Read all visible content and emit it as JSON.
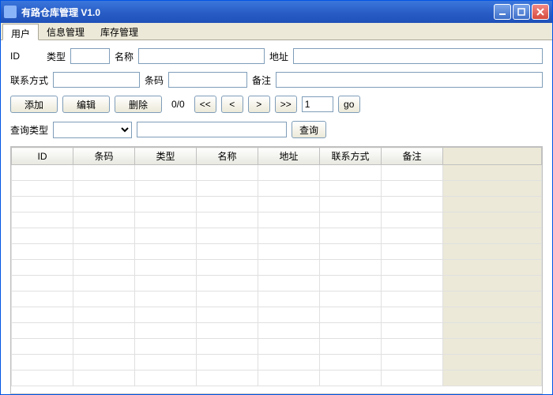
{
  "window": {
    "title": "有路仓库管理  V1.0"
  },
  "menu": {
    "user": "用户",
    "infoMgmt": "信息管理",
    "stockMgmt": "库存管理"
  },
  "form": {
    "idLabel": "ID",
    "typeLabel": "类型",
    "nameLabel": "名称",
    "addressLabel": "地址",
    "contactLabel": "联系方式",
    "barcodeLabel": "条码",
    "remarkLabel": "备注",
    "idValue": "",
    "typeValue": "",
    "nameValue": "",
    "addressValue": "",
    "contactValue": "",
    "barcodeValue": "",
    "remarkValue": ""
  },
  "toolbar": {
    "addLabel": "添加",
    "editLabel": "编辑",
    "deleteLabel": "删除",
    "pagerInfo": "0/0",
    "firstLabel": "<<",
    "prevLabel": "<",
    "nextLabel": ">",
    "lastLabel": ">>",
    "pageValue": "1",
    "goLabel": "go"
  },
  "search": {
    "typeLabel": "查询类型",
    "typeValue": "",
    "keywordValue": "",
    "btnLabel": "查询"
  },
  "table": {
    "headers": {
      "id": "ID",
      "barcode": "条码",
      "type": "类型",
      "name": "名称",
      "address": "地址",
      "contact": "联系方式",
      "remark": "备注"
    }
  }
}
